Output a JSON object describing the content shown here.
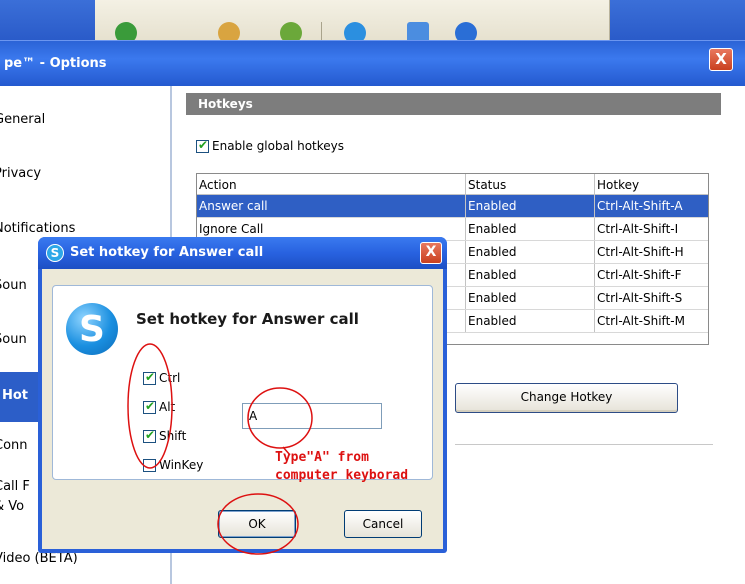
{
  "main_window": {
    "title": "pe™ - Options",
    "close_label": "X",
    "sidebar": [
      {
        "label": "General"
      },
      {
        "label": "Privacy"
      },
      {
        "label": "Notifications"
      },
      {
        "label": "Soun"
      },
      {
        "label": "Soun"
      },
      {
        "label": "Hot"
      },
      {
        "label": "Conn"
      },
      {
        "label": "Call F"
      },
      {
        "label": "& Vo"
      },
      {
        "label": "Video (BETA)"
      }
    ],
    "section_header": "Hotkeys",
    "enable_label": "Enable global hotkeys",
    "enable_checked": true,
    "table": {
      "headers": [
        "Action",
        "Status",
        "Hotkey"
      ],
      "rows": [
        {
          "action": "Answer call",
          "status": "Enabled",
          "hotkey": "Ctrl-Alt-Shift-A"
        },
        {
          "action": "Ignore Call",
          "status": "Enabled",
          "hotkey": "Ctrl-Alt-Shift-I"
        },
        {
          "action": "",
          "status": "Enabled",
          "hotkey": "Ctrl-Alt-Shift-H"
        },
        {
          "action": "",
          "status": "Enabled",
          "hotkey": "Ctrl-Alt-Shift-F"
        },
        {
          "action": "",
          "status": "Enabled",
          "hotkey": "Ctrl-Alt-Shift-S"
        },
        {
          "action": "",
          "status": "Enabled",
          "hotkey": "Ctrl-Alt-Shift-M"
        }
      ]
    },
    "change_button": "Change Hotkey"
  },
  "dialog": {
    "title": "Set hotkey for Answer call",
    "heading": "Set hotkey for Answer call",
    "modifiers": [
      {
        "label": "Ctrl",
        "checked": true
      },
      {
        "label": "Alt",
        "checked": true
      },
      {
        "label": "Shift",
        "checked": true
      },
      {
        "label": "WinKey",
        "checked": false
      }
    ],
    "key_value": "A",
    "ok_label": "OK",
    "cancel_label": "Cancel",
    "close_label": "X"
  },
  "annotation": {
    "text": "Type\"A\" from\ncomputer keyborad",
    "color": "#dd1111"
  },
  "colors": {
    "title_blue": "#2b63d6",
    "selection_blue": "#2f5fc4",
    "panel_header_gray": "#7d7d7d",
    "close_red": "#c9401f"
  },
  "toolbar_icons": [
    "add-contact-icon",
    "search-icon",
    "add-group-icon",
    "chat-icon",
    "share-icon",
    "profile-icon"
  ]
}
